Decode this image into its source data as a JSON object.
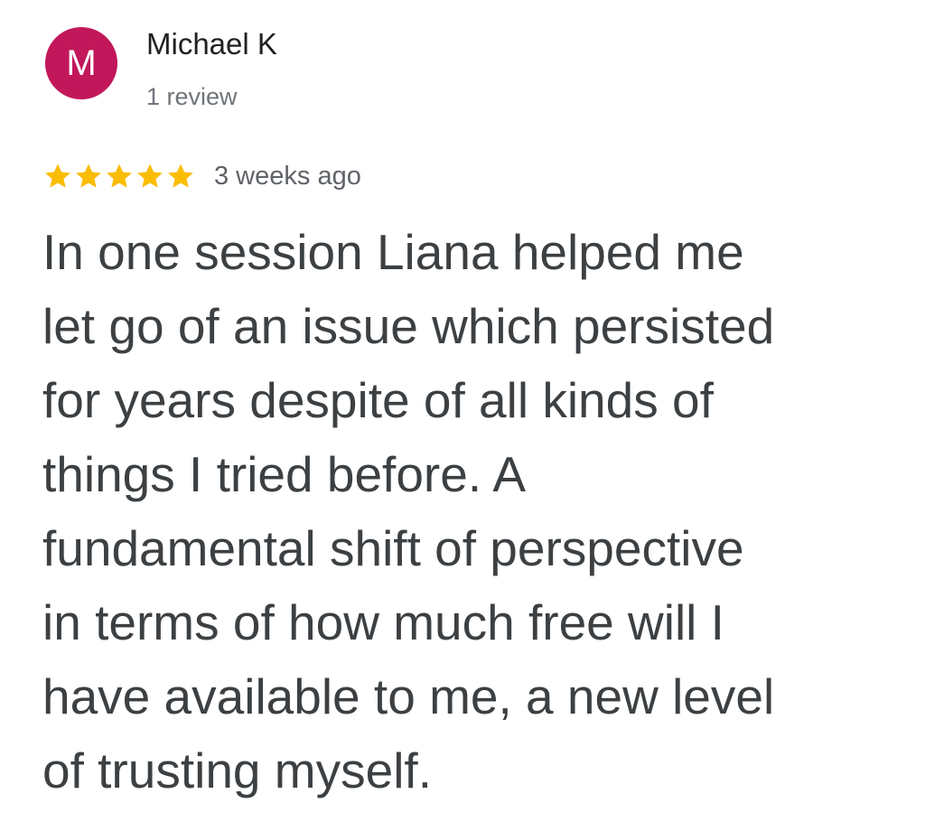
{
  "review": {
    "author": {
      "initial": "M",
      "avatar_color": "#c2185b",
      "name": "Michael K",
      "review_count": "1 review"
    },
    "rating": {
      "stars": 5,
      "max_stars": 5,
      "star_color": "#fbbc04"
    },
    "timestamp": "3 weeks ago",
    "text_lines": [
      "In one session Liana helped me",
      "let go of an issue which persisted",
      "for years despite of all kinds of",
      "things I tried before. A",
      "fundamental shift of perspective",
      "in terms of how much free will I",
      "have available to me, a new level",
      "of trusting myself."
    ]
  },
  "icons": {
    "star": "star-icon"
  }
}
